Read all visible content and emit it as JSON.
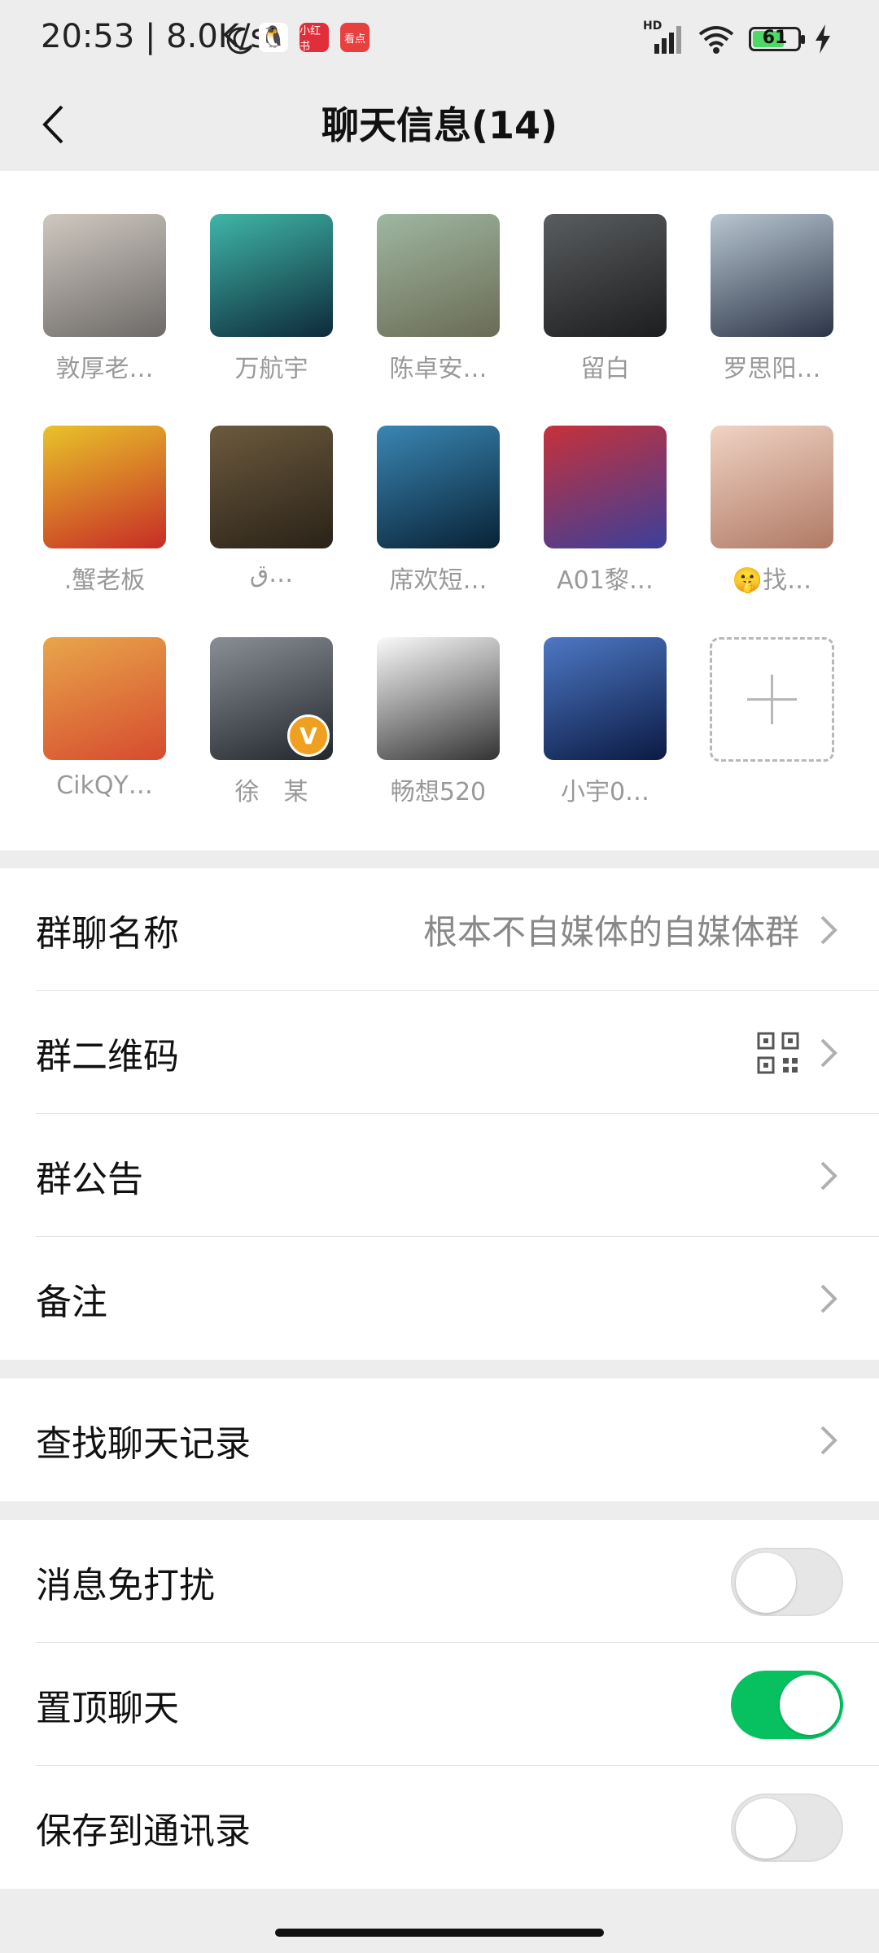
{
  "status_bar": {
    "time_speed": "20:53 | 8.0K/s",
    "network": "HD",
    "battery": "61",
    "app_icons": [
      "qq-icon",
      "xiaohongshu-icon",
      "kandian-icon"
    ],
    "app_labels": {
      "xhs": "小红书",
      "kd": "看点"
    }
  },
  "header": {
    "title": "聊天信息(14)"
  },
  "members": [
    {
      "name": "敦厚老…",
      "avatar": "dog-photo",
      "colors": [
        "#cfc8c0",
        "#6d6a68"
      ]
    },
    {
      "name": "万航宇",
      "avatar": "aurora-photo",
      "colors": [
        "#3fb6a7",
        "#0e2a3a"
      ]
    },
    {
      "name": "陈卓安…",
      "avatar": "lake-person-photo",
      "colors": [
        "#9fb7a1",
        "#6a6b55"
      ]
    },
    {
      "name": "留白",
      "avatar": "silhouette-photo",
      "colors": [
        "#5a5d5f",
        "#1c1d1f"
      ]
    },
    {
      "name": "罗思阳…",
      "avatar": "suit-man-photo",
      "colors": [
        "#b8c6d1",
        "#2c3547"
      ]
    },
    {
      "name": ".蟹老板",
      "avatar": "red-baby-photo",
      "colors": [
        "#e8c32a",
        "#c72c26"
      ]
    },
    {
      "name": "ق…",
      "avatar": "movie-boy-photo",
      "colors": [
        "#6b5a3d",
        "#2a2218"
      ]
    },
    {
      "name": "席欢短…",
      "avatar": "whale-photo",
      "colors": [
        "#3a86b3",
        "#082236"
      ]
    },
    {
      "name": "A01黎…",
      "avatar": "ultraman-photo",
      "colors": [
        "#c7313a",
        "#3b3f9a"
      ]
    },
    {
      "name": "🤫找…",
      "avatar": "glasses-kid-photo",
      "colors": [
        "#f0d2c4",
        "#b07a64"
      ]
    },
    {
      "name": "CikQY…",
      "avatar": "cartoon-girl-avatar",
      "colors": [
        "#e8a64a",
        "#d64b2f"
      ]
    },
    {
      "name": "徐　某",
      "avatar": "suit-tie-photo",
      "colors": [
        "#8a8f95",
        "#22262d"
      ]
    },
    {
      "name": "畅想520",
      "avatar": "cartoon-boy-avatar",
      "colors": [
        "#fafafa",
        "#333333"
      ]
    },
    {
      "name": "小宇0…",
      "avatar": "blue-road-photo",
      "colors": [
        "#4d78c4",
        "#0b1a44"
      ]
    }
  ],
  "add_member_label": "add-member",
  "group_info": {
    "name_label": "群聊名称",
    "name_value": "根本不自媒体的自媒体群",
    "qr_label": "群二维码",
    "notice_label": "群公告",
    "remark_label": "备注"
  },
  "search_history_label": "查找聊天记录",
  "toggles": {
    "mute_label": "消息免打扰",
    "mute_on": false,
    "pin_label": "置顶聊天",
    "pin_on": true,
    "save_label": "保存到通讯录",
    "save_on": false
  },
  "colors": {
    "accent_green": "#07c160",
    "background": "#ededed"
  }
}
